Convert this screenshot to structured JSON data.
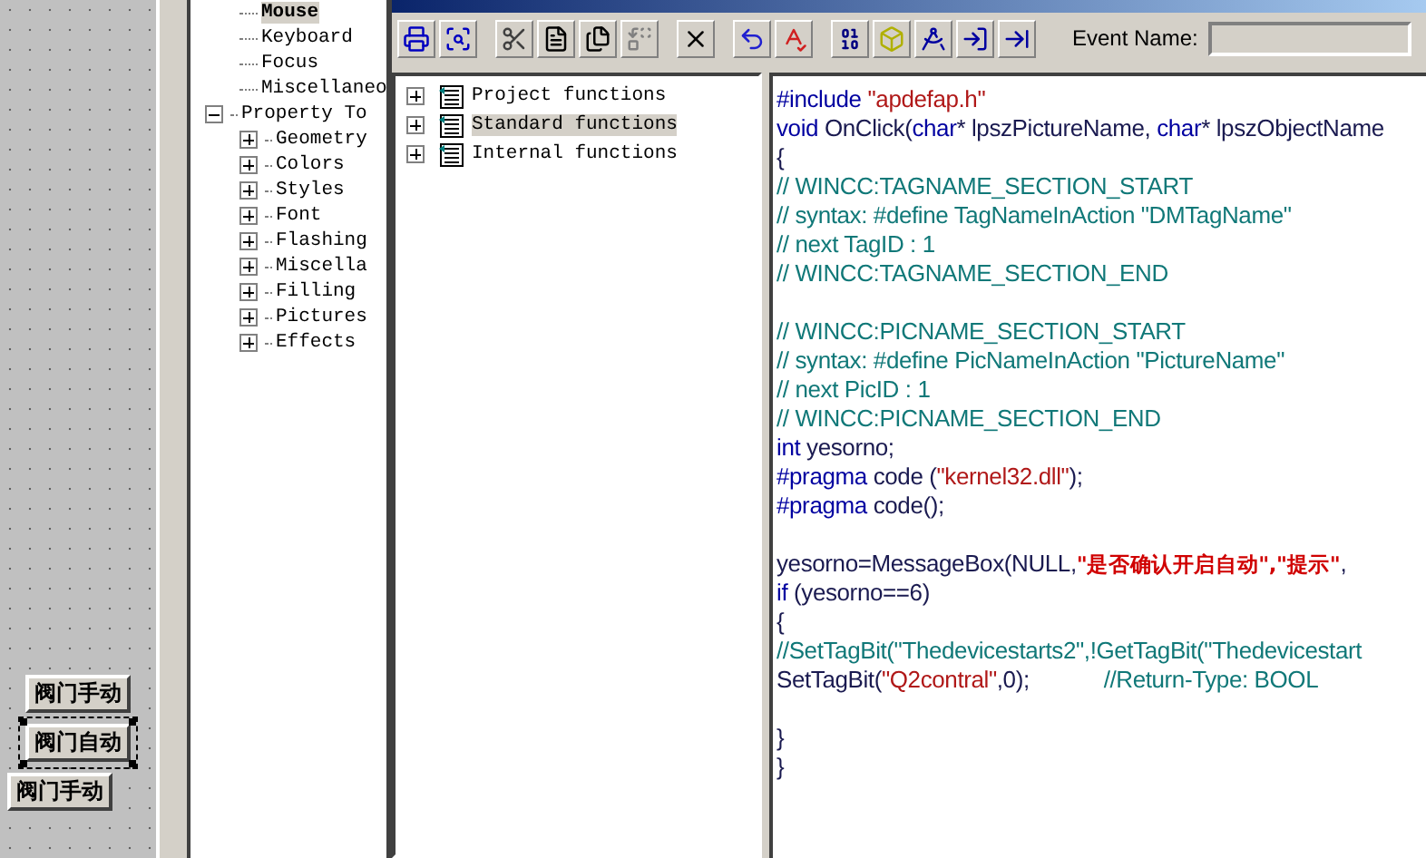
{
  "canvas": {
    "buttons": [
      {
        "label": "阀门手动",
        "selected": false
      },
      {
        "label": "阀门自动",
        "selected": true
      },
      {
        "label": "阀门手动",
        "selected": false
      }
    ]
  },
  "property_tree": {
    "items": [
      {
        "label": "Mouse",
        "selected": true
      },
      {
        "label": "Keyboard",
        "selected": false
      },
      {
        "label": "Focus",
        "selected": false
      },
      {
        "label": "Miscellaneo",
        "selected": false
      },
      {
        "label": "Property To",
        "selected": false,
        "expanded": true,
        "children": [
          {
            "label": "Geometry",
            "selected": false,
            "expanded": false
          },
          {
            "label": "Colors",
            "selected": false,
            "expanded": false
          },
          {
            "label": "Styles",
            "selected": false,
            "expanded": false
          },
          {
            "label": "Font",
            "selected": false,
            "expanded": false
          },
          {
            "label": "Flashing",
            "selected": false,
            "expanded": false
          },
          {
            "label": "Miscella",
            "selected": false,
            "expanded": false
          },
          {
            "label": "Filling",
            "selected": false,
            "expanded": false
          },
          {
            "label": "Pictures",
            "selected": false,
            "expanded": false
          },
          {
            "label": "Effects",
            "selected": false,
            "expanded": false
          }
        ]
      }
    ]
  },
  "event_name": {
    "label": "Event Name:",
    "disabled": true
  },
  "function_tree": {
    "items": [
      {
        "label": "Project functions",
        "selected": false,
        "expanded": false
      },
      {
        "label": "Standard functions",
        "selected": true,
        "expanded": false
      },
      {
        "label": "Internal functions",
        "selected": false,
        "expanded": false
      }
    ]
  },
  "code_editor": {
    "lines": [
      {
        "kind": "code",
        "segments": [
          {
            "text": "#include ",
            "kind": "keyword"
          },
          {
            "text": "\"apdefap.h\"",
            "kind": "string"
          }
        ]
      },
      {
        "kind": "code",
        "segments": [
          {
            "text": "void",
            "kind": "keyword"
          },
          {
            "text": " OnClick(",
            "kind": "plain"
          },
          {
            "text": "char",
            "kind": "keyword"
          },
          {
            "text": "* lpszPictureName, ",
            "kind": "plain"
          },
          {
            "text": "char",
            "kind": "keyword"
          },
          {
            "text": "* lpszObjectName",
            "kind": "plain"
          }
        ]
      },
      {
        "kind": "code",
        "segments": [
          {
            "text": "{",
            "kind": "plain"
          }
        ]
      },
      {
        "kind": "code",
        "segments": [
          {
            "text": "// WINCC:TAGNAME_SECTION_START",
            "kind": "comment"
          }
        ]
      },
      {
        "kind": "code",
        "segments": [
          {
            "text": "// syntax: #define TagNameInAction \"DMTagName\"",
            "kind": "comment"
          }
        ]
      },
      {
        "kind": "code",
        "segments": [
          {
            "text": "// next TagID : 1",
            "kind": "comment"
          }
        ]
      },
      {
        "kind": "code",
        "segments": [
          {
            "text": "// WINCC:TAGNAME_SECTION_END",
            "kind": "comment"
          }
        ]
      },
      {
        "kind": "blank"
      },
      {
        "kind": "code",
        "segments": [
          {
            "text": "// WINCC:PICNAME_SECTION_START",
            "kind": "comment"
          }
        ]
      },
      {
        "kind": "code",
        "segments": [
          {
            "text": "// syntax: #define PicNameInAction \"PictureName\"",
            "kind": "comment"
          }
        ]
      },
      {
        "kind": "code",
        "segments": [
          {
            "text": "// next PicID : 1",
            "kind": "comment"
          }
        ]
      },
      {
        "kind": "code",
        "segments": [
          {
            "text": "// WINCC:PICNAME_SECTION_END",
            "kind": "comment"
          }
        ]
      },
      {
        "kind": "code",
        "segments": [
          {
            "text": "int",
            "kind": "keyword"
          },
          {
            "text": " yesorno;",
            "kind": "plain"
          }
        ]
      },
      {
        "kind": "code",
        "segments": [
          {
            "text": "#pragma",
            "kind": "keyword"
          },
          {
            "text": " code (",
            "kind": "plain"
          },
          {
            "text": "\"kernel32.dll\"",
            "kind": "string"
          },
          {
            "text": ");",
            "kind": "plain"
          }
        ]
      },
      {
        "kind": "code",
        "segments": [
          {
            "text": "#pragma",
            "kind": "keyword"
          },
          {
            "text": " code();",
            "kind": "plain"
          }
        ]
      },
      {
        "kind": "blank"
      },
      {
        "kind": "code",
        "segments": [
          {
            "text": "yesorno=MessageBox(NULL,",
            "kind": "plain"
          },
          {
            "text": "\"是否确认开启自动\",\"提示\"",
            "kind": "cjk_string"
          },
          {
            "text": ",",
            "kind": "plain"
          }
        ]
      },
      {
        "kind": "code",
        "segments": [
          {
            "text": "if",
            "kind": "keyword"
          },
          {
            "text": " (yesorno==6)",
            "kind": "plain"
          }
        ]
      },
      {
        "kind": "code",
        "segments": [
          {
            "text": "{",
            "kind": "plain"
          }
        ]
      },
      {
        "kind": "code",
        "segments": [
          {
            "text": "//SetTagBit(\"Thedevicestarts2\",!GetTagBit(\"Thedevicestart",
            "kind": "comment"
          }
        ]
      },
      {
        "kind": "code",
        "segments": [
          {
            "text": "SetTagBit(",
            "kind": "plain"
          },
          {
            "text": "\"Q2contral\"",
            "kind": "string"
          },
          {
            "text": ",0);            ",
            "kind": "plain"
          },
          {
            "text": "//Return-Type: BOOL",
            "kind": "comment"
          }
        ]
      },
      {
        "kind": "blank"
      },
      {
        "kind": "code",
        "segments": [
          {
            "text": "}",
            "kind": "plain"
          }
        ]
      },
      {
        "kind": "code",
        "segments": [
          {
            "text": "}",
            "kind": "plain"
          }
        ]
      }
    ]
  }
}
